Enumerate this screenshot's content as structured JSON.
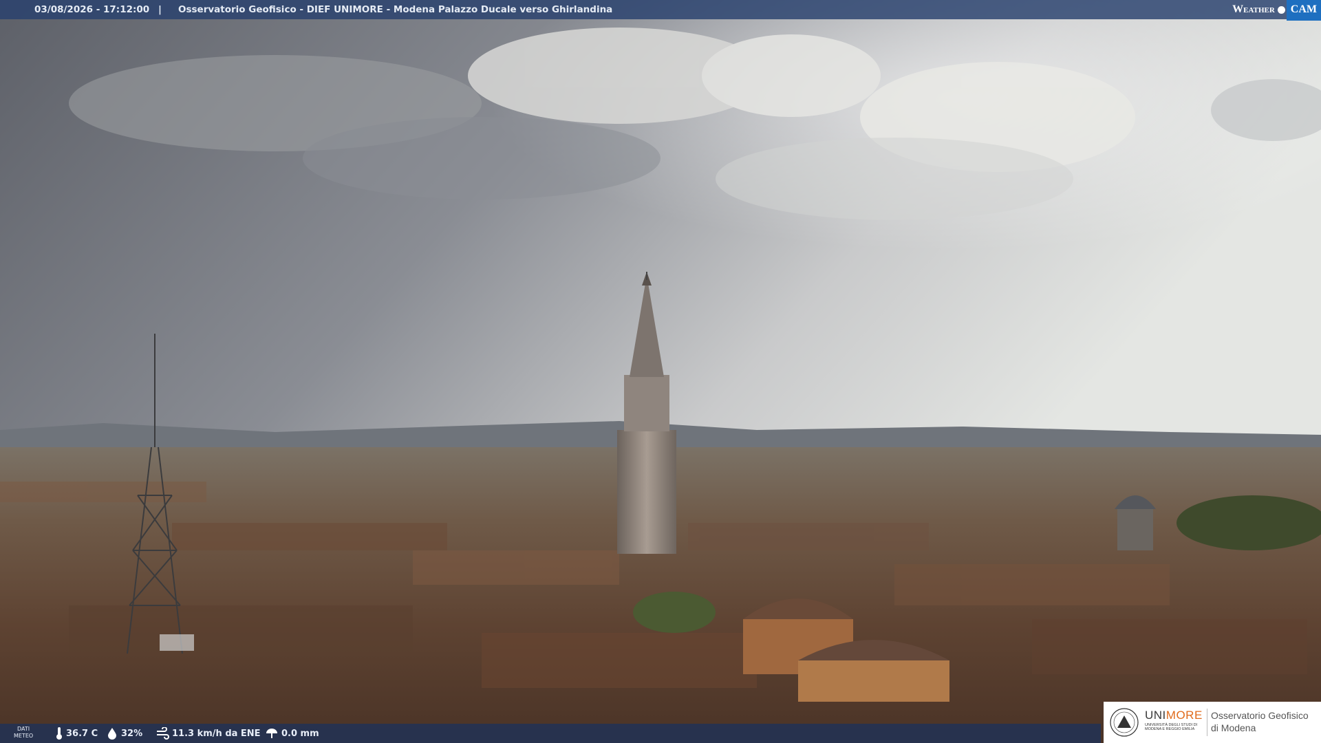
{
  "header": {
    "datetime": "03/08/2026 - 17:12:00",
    "separator": "|",
    "title": "Osservatorio Geofisico - DIEF UNIMORE - Modena Palazzo Ducale verso Ghirlandina"
  },
  "weathercam_logo": {
    "word1": "Weather",
    "word2": "CAM"
  },
  "weather_data": {
    "label_line1": "DATI",
    "label_line2": "METEO",
    "temperature": "36.7 C",
    "humidity": "32%",
    "wind": "11.3 km/h da ENE",
    "rain": "0.0 mm"
  },
  "unimore_logo": {
    "uni": "UNI",
    "more": "MORE",
    "subtitle": "UNIVERSITÀ DEGLI STUDI DI MODENA E REGGIO EMILIA",
    "observatory_line1": "Osservatorio Geofisico",
    "observatory_line2": "di Modena"
  },
  "icons": [
    "thermometer-icon",
    "humidity-drop-icon",
    "wind-icon",
    "rain-icon"
  ],
  "colors": {
    "bar": "#28416e",
    "accent_orange": "#e06a1a",
    "cam_blue": "#1e6fc0"
  }
}
